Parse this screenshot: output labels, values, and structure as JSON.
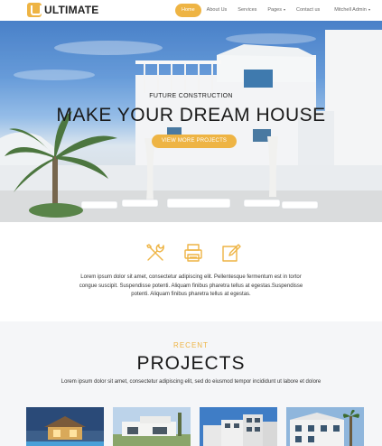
{
  "brand": {
    "name": "ULTIMATE",
    "logo_icon": "u-logo-icon",
    "accent": "#eeb444"
  },
  "nav": {
    "items": [
      {
        "label": "Home",
        "active": true
      },
      {
        "label": "About Us"
      },
      {
        "label": "Services"
      },
      {
        "label": "Pages",
        "dropdown": true
      },
      {
        "label": "Contact us"
      }
    ],
    "user": {
      "label": "Mitchell Admin",
      "dropdown": true
    }
  },
  "hero": {
    "subtitle": "FUTURE  CONSTRUCTION",
    "title": "MAKE YOUR DREAM HOUSE",
    "button": "VIEW MORE PROJECTS"
  },
  "features": {
    "icons": [
      "tools-icon",
      "printer-icon",
      "edit-icon"
    ],
    "text": "Lorem ipsum dolor sit amet, consectetur adipiscing elit. Pellentesque fermentum est in tortor congue suscipit. Suspendisse potenti. Aliquam finibus pharetra tellus at egestas.Suspendisse potenti. Aliquam finibus pharetra tellus at egestas."
  },
  "projects": {
    "kicker": "RECENT",
    "title": "PROJECTS",
    "description": "Lorem ipsum dolor sit amet, consectetur adipiscing elit, sed do eiusmod tempor incididunt ut labore et dolore"
  }
}
